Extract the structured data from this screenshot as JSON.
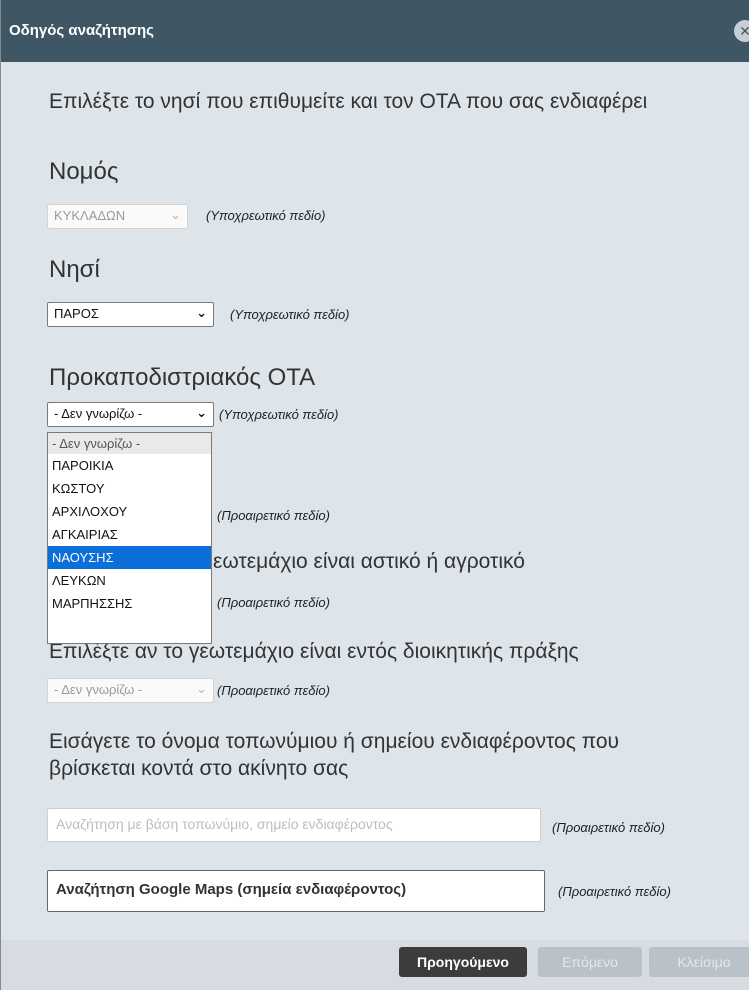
{
  "dialog": {
    "title": "Οδηγός αναζήτησης",
    "close_glyph": "✕"
  },
  "intro": "Επιλέξτε το νησί που επιθυμείτε και τον ΟΤΑ που σας ενδιαφέρει",
  "nomos": {
    "label": "Νομός",
    "value": "ΚΥΚΛΑΔΩΝ",
    "hint": "(Υποχρεωτικό πεδίο)",
    "disabled": true
  },
  "nisi": {
    "label": "Νησί",
    "value": "ΠΑΡΟΣ",
    "hint": "(Υποχρεωτικό πεδίο)"
  },
  "ota": {
    "label": "Προκαποδιστριακός ΟΤΑ",
    "value": "- Δεν γνωρίζω -",
    "hint": "(Υποχρεωτικό πεδίο)",
    "options": [
      "- Δεν γνωρίζω -",
      "ΠΑΡΟΙΚΙΑ",
      "ΚΩΣΤΟΥ",
      "ΑΡΧΙΛΟΧΟΥ",
      "ΑΓΚΑΙΡΙΑΣ",
      "ΝΑΟΥΣΗΣ",
      "ΛΕΥΚΩΝ",
      "ΜΑΡΠΗΣΣΗΣ"
    ],
    "highlighted_option": "ΝΑΟΥΣΗΣ"
  },
  "optional_1": {
    "hint": "(Προαιρετικό πεδίο)"
  },
  "urban_rural": {
    "label_visible": "εωτεμάχιο είναι αστικό ή αγροτικό",
    "hint": "(Προαιρετικό πεδίο)"
  },
  "admin_act": {
    "label": "Επιλέξτε αν το γεωτεμάχιο είναι εντός διοικητικής πράξης",
    "value": "- Δεν γνωρίζω -",
    "hint": "(Προαιρετικό πεδίο)",
    "disabled": true
  },
  "toponym": {
    "label": "Εισάγετε το όνομα τοπωνύμιου ή σημείου ενδιαφέροντος που βρίσκεται κοντά στο ακίνητο σας",
    "placeholder": "Αναζήτηση με βάση τοπωνύμιο, σημείο ενδιαφέροντος",
    "hint": "(Προαιρετικό πεδίο)"
  },
  "google": {
    "placeholder": "Αναζήτηση Google Maps (σημεία ενδιαφέροντος)",
    "hint": "(Προαιρετικό πεδίο)"
  },
  "footer": {
    "prev_label": "Προηγούμενο",
    "next_label": "Επόμενο",
    "close_label": "Κλείσιμο"
  },
  "colors": {
    "titlebar": "#3f5765",
    "dialog_bg": "#dde4ea",
    "selected_option": "#0a6fd8",
    "primary_button": "#3c3c3c",
    "disabled_button": "#b9c2c8"
  }
}
